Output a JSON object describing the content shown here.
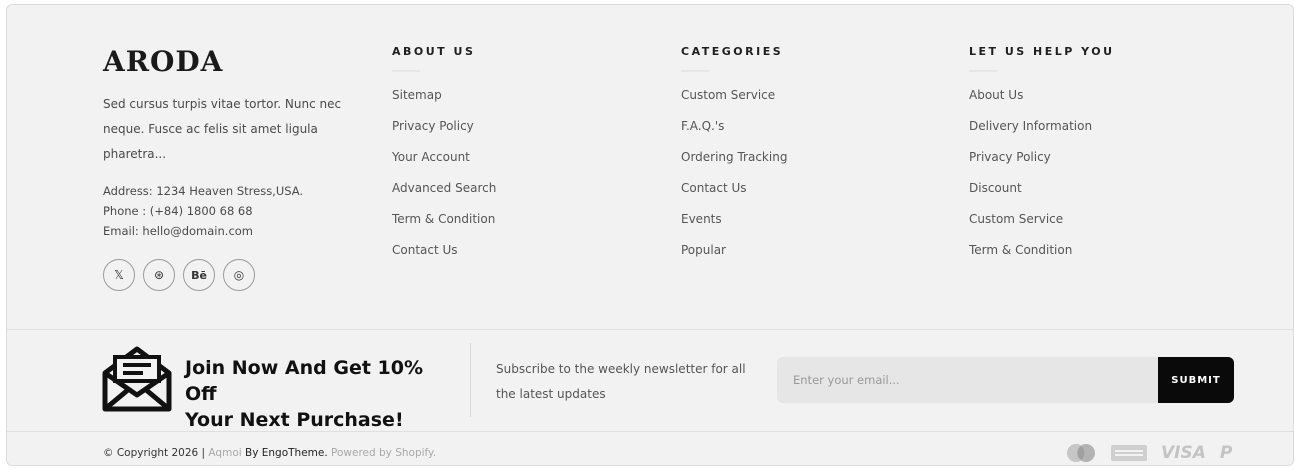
{
  "brand": {
    "logo": "ARODA",
    "description": "Sed cursus turpis vitae tortor. Nunc nec neque. Fusce ac felis sit amet ligula pharetra...",
    "address": "Address: 1234 Heaven Stress,USA.",
    "phone": "Phone : (+84) 1800 68 68",
    "email": "Email: hello@domain.com",
    "socials": [
      {
        "name": "x-icon",
        "glyph": "𝕏"
      },
      {
        "name": "dribbble-icon",
        "glyph": "⊛"
      },
      {
        "name": "behance-icon",
        "glyph": "Bē"
      },
      {
        "name": "instagram-icon",
        "glyph": "◎"
      }
    ]
  },
  "about": {
    "title": "ABOUT US",
    "items": [
      "Sitemap",
      "Privacy Policy",
      "Your Account",
      "Advanced Search",
      "Term & Condition",
      "Contact Us"
    ]
  },
  "categories": {
    "title": "CATEGORIES",
    "items": [
      "Custom Service",
      "F.A.Q.'s",
      "Ordering Tracking",
      "Contact Us",
      "Events",
      "Popular"
    ]
  },
  "help": {
    "title": "LET US HELP YOU",
    "items": [
      "About Us",
      "Delivery Information",
      "Privacy Policy",
      "Discount",
      "Custom Service",
      "Term & Condition"
    ]
  },
  "newsletter": {
    "title_line1": "Join Now And Get 10% Off",
    "title_line2": "Your Next Purchase!",
    "subtitle": "Subscribe to the weekly newsletter for all the latest updates",
    "placeholder": "Enter your email...",
    "submit": "SUBMIT"
  },
  "copyright": {
    "prefix": "© Copyright 2026 | ",
    "site": "Aqmoi",
    "by": " By EngoTheme.",
    "powered": " Powered by Shopify."
  },
  "payments": [
    "mastercard-icon",
    "amex-icon",
    "VISA",
    "P"
  ]
}
